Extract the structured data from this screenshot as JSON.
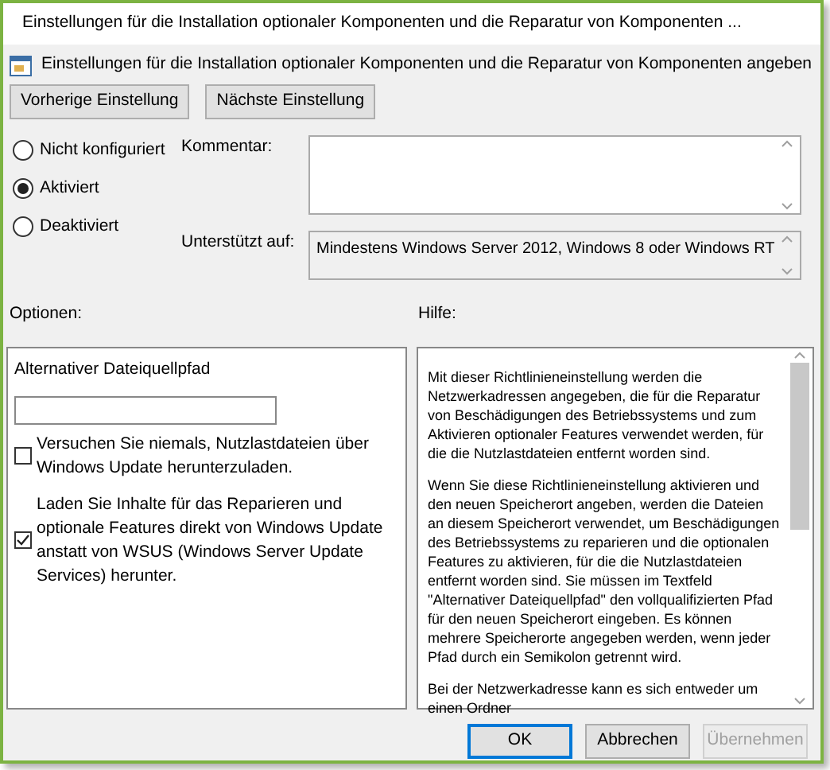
{
  "window": {
    "title": "Einstellungen für die Installation optionaler Komponenten und die Reparatur von Komponenten ..."
  },
  "header": {
    "title": "Einstellungen für die Installation optionaler Komponenten und die Reparatur von Komponenten angeben"
  },
  "nav_buttons": [
    "Vorherige Einstellung",
    "Nächste Einstellung"
  ],
  "state_options": [
    {
      "label": "Nicht konfiguriert",
      "selected": false
    },
    {
      "label": "Aktiviert",
      "selected": true
    },
    {
      "label": "Deaktiviert",
      "selected": false
    }
  ],
  "comment": {
    "label": "Kommentar:"
  },
  "supported": {
    "label": "Unterstützt auf:",
    "value": "Mindestens Windows Server 2012, Windows 8 oder Windows RT"
  },
  "options": {
    "label": "Optionen:",
    "path_label": "Alternativer Dateiquellpfad",
    "checkboxes": [
      {
        "label": "Versuchen Sie niemals, Nutzlastdateien über Windows Update herunterzuladen.",
        "checked": false
      },
      {
        "label": "Laden Sie Inhalte für das Reparieren und optionale Features direkt von Windows Update anstatt von WSUS (Windows Server Update Services) herunter.",
        "checked": true
      }
    ]
  },
  "help": {
    "label": "Hilfe:",
    "paragraphs": [
      "Mit dieser Richtlinieneinstellung werden die Netzwerkadressen angegeben, die für die Reparatur von Beschädigungen des Betriebssystems und zum Aktivieren optionaler Features verwendet werden, für die die Nutzlastdateien entfernt worden sind.",
      "Wenn Sie diese Richtlinieneinstellung aktivieren und den neuen Speicherort angeben, werden die Dateien an diesem Speicherort verwendet, um Beschädigungen des Betriebssystems zu reparieren und die optionalen Features zu aktivieren, für die die Nutzlastdateien entfernt worden sind. Sie müssen im Textfeld \"Alternativer Dateiquellpfad\" den vollqualifizierten Pfad für den neuen Speicherort eingeben. Es können mehrere Speicherorte angegeben werden, wenn jeder Pfad durch ein Semikolon getrennt wird.",
      "Bei der Netzwerkadresse kann es sich entweder um einen Ordner"
    ]
  },
  "buttons": [
    {
      "label": "OK",
      "disabled": false,
      "default": true
    },
    {
      "label": "Abbrechen",
      "disabled": false,
      "default": false
    },
    {
      "label": "Übernehmen",
      "disabled": true,
      "default": false
    }
  ]
}
